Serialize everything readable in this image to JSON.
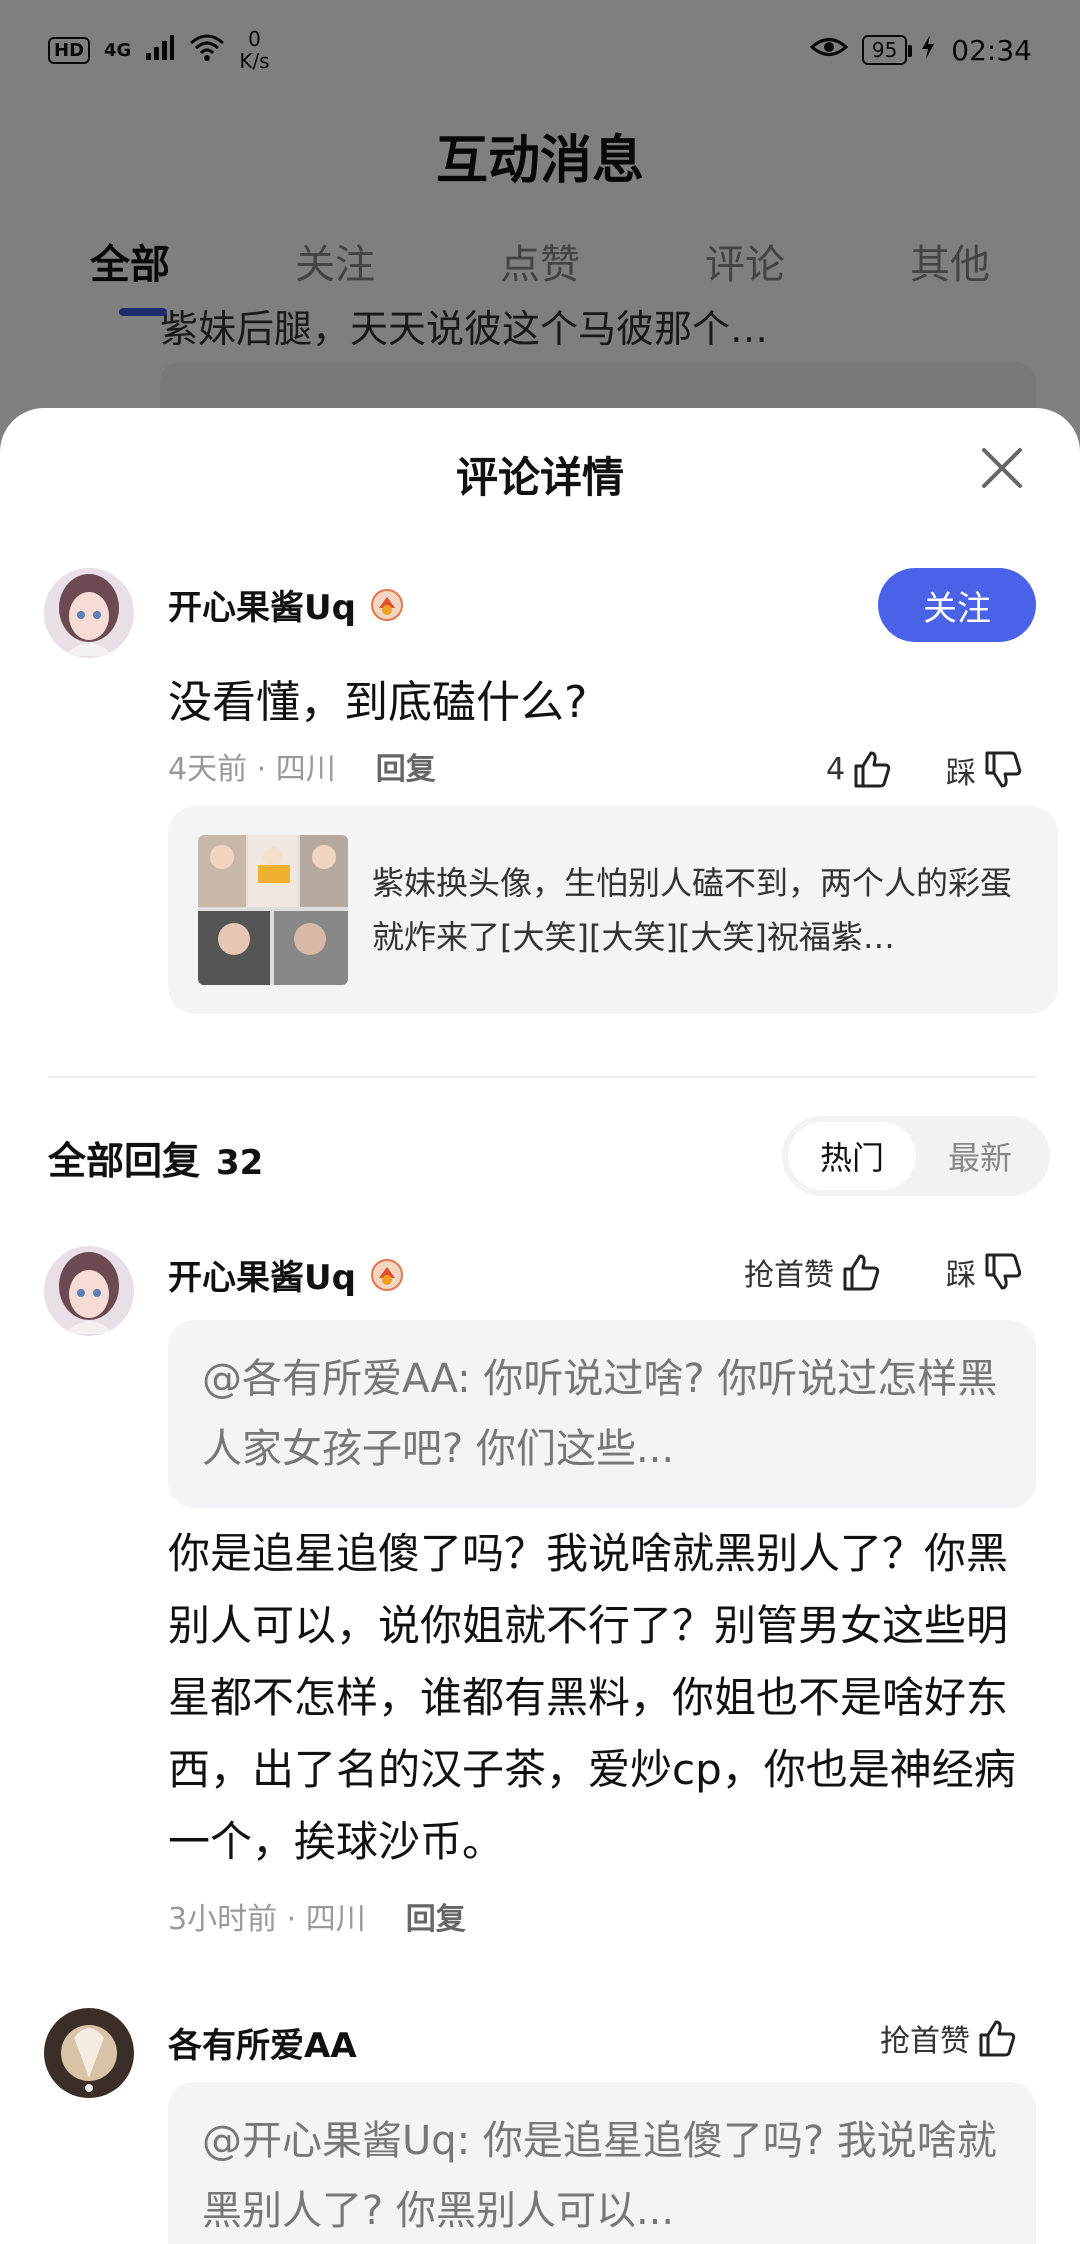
{
  "status_bar": {
    "hd": "HD",
    "network": "4G",
    "speed_value": "0",
    "speed_unit": "K/s",
    "battery": "95",
    "time": "02:34"
  },
  "background": {
    "title": "互动消息",
    "tabs": [
      {
        "label": "全部",
        "active": true
      },
      {
        "label": "关注",
        "active": false
      },
      {
        "label": "点赞",
        "active": false
      },
      {
        "label": "评论",
        "active": false
      },
      {
        "label": "其他",
        "active": false
      }
    ],
    "snippet": "紫妹后腿，天天说彼这个马彼那个…"
  },
  "sheet": {
    "title": "评论详情",
    "main_comment": {
      "username": "开心果酱Uq",
      "follow_label": "关注",
      "text": "没看懂，到底磕什么?",
      "time": "4天前 · 四川",
      "reply_label": "回复",
      "like_count": "4",
      "dislike_label": "踩",
      "quoted_post": "紫妹换头像，生怕别人磕不到，两个人的彩蛋就炸来了[大笑][大笑][大笑]祝福紫…"
    },
    "replies_header": {
      "label": "全部回复",
      "count": "32",
      "sort_hot": "热门",
      "sort_new": "最新"
    },
    "replies": [
      {
        "username": "开心果酱Uq",
        "first_like_label": "抢首赞",
        "dislike_label": "踩",
        "quote": "@各有所爱AA: 你听说过啥? 你听说过怎样黑人家女孩子吧? 你们这些...",
        "text": "你是追星追傻了吗？我说啥就黑别人了？你黑别人可以，说你姐就不行了？别管男女这些明星都不怎样，谁都有黑料，你姐也不是啥好东西，出了名的汉子茶，爱炒cp，你也是神经病一个，挨球沙币。",
        "time": "3小时前 · 四川",
        "reply_label": "回复"
      },
      {
        "username": "各有所爱AA",
        "first_like_label": "抢首赞",
        "quote": "@开心果酱Uq: 你是追星追傻了吗? 我说啥就黑别人了? 你黑别人可以..."
      }
    ]
  },
  "colors": {
    "accent": "#4a62e8",
    "overlay": "rgba(0,0,0,0.5)"
  }
}
